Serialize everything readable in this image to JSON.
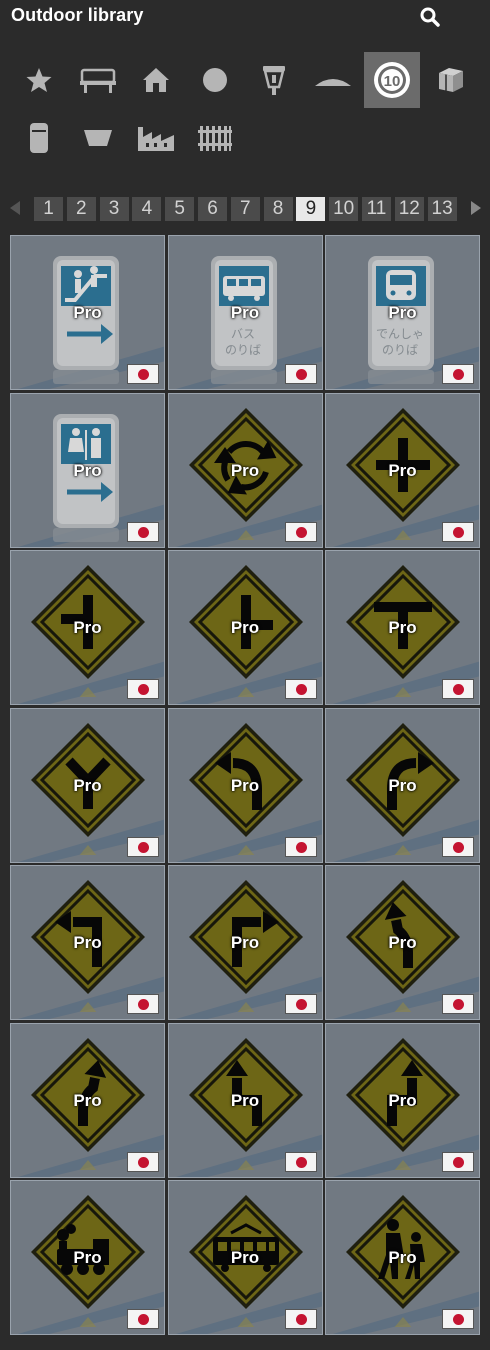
{
  "header": {
    "title": "Outdoor library",
    "search_icon": "search-icon"
  },
  "categories": [
    {
      "id": "favorites",
      "icon": "star-icon",
      "selected": false
    },
    {
      "id": "bench",
      "icon": "bench-icon",
      "selected": false
    },
    {
      "id": "house",
      "icon": "house-icon",
      "selected": false
    },
    {
      "id": "sphere",
      "icon": "sphere-icon",
      "selected": false
    },
    {
      "id": "lantern",
      "icon": "lantern-icon",
      "selected": false
    },
    {
      "id": "mound",
      "icon": "mound-icon",
      "selected": false
    },
    {
      "id": "road-sign",
      "icon": "speed-sign-icon",
      "label": "10",
      "selected": true
    },
    {
      "id": "crate",
      "icon": "crate-icon",
      "selected": false
    },
    {
      "id": "bin",
      "icon": "bin-icon",
      "selected": false
    },
    {
      "id": "planter",
      "icon": "planter-icon",
      "selected": false
    },
    {
      "id": "factory",
      "icon": "factory-icon",
      "selected": false
    },
    {
      "id": "fence",
      "icon": "fence-icon",
      "selected": false
    }
  ],
  "pagination": {
    "prev_icon": "chevron-left-icon",
    "next_icon": "chevron-right-icon",
    "pages": [
      "1",
      "2",
      "3",
      "4",
      "5",
      "6",
      "7",
      "8",
      "9",
      "10",
      "11",
      "12",
      "13"
    ],
    "current": "9"
  },
  "items": [
    {
      "icon": "escalator-guide-sign-icon",
      "badge": "Pro",
      "flag": "japan-flag-icon"
    },
    {
      "icon": "bus-stop-sign-icon",
      "badge": "Pro",
      "flag": "japan-flag-icon",
      "sign_text": "バス のりば"
    },
    {
      "icon": "train-stop-sign-icon",
      "badge": "Pro",
      "flag": "japan-flag-icon",
      "sign_text": "でんしゃ のりば"
    },
    {
      "icon": "restroom-guide-sign-icon",
      "badge": "Pro",
      "flag": "japan-flag-icon"
    },
    {
      "icon": "roundabout-warning-sign-icon",
      "badge": "Pro",
      "flag": "japan-flag-icon"
    },
    {
      "icon": "crossroad-warning-sign-icon",
      "badge": "Pro",
      "flag": "japan-flag-icon"
    },
    {
      "icon": "side-road-left-warning-sign-icon",
      "badge": "Pro",
      "flag": "japan-flag-icon"
    },
    {
      "icon": "side-road-right-warning-sign-icon",
      "badge": "Pro",
      "flag": "japan-flag-icon"
    },
    {
      "icon": "t-junction-warning-sign-icon",
      "badge": "Pro",
      "flag": "japan-flag-icon"
    },
    {
      "icon": "y-junction-warning-sign-icon",
      "badge": "Pro",
      "flag": "japan-flag-icon"
    },
    {
      "icon": "curve-left-warning-sign-icon",
      "badge": "Pro",
      "flag": "japan-flag-icon"
    },
    {
      "icon": "curve-right-warning-sign-icon",
      "badge": "Pro",
      "flag": "japan-flag-icon"
    },
    {
      "icon": "sharp-turn-left-warning-sign-icon",
      "badge": "Pro",
      "flag": "japan-flag-icon"
    },
    {
      "icon": "sharp-turn-right-warning-sign-icon",
      "badge": "Pro",
      "flag": "japan-flag-icon"
    },
    {
      "icon": "reverse-curve-left-warning-sign-icon",
      "badge": "Pro",
      "flag": "japan-flag-icon"
    },
    {
      "icon": "reverse-curve-right-warning-sign-icon",
      "badge": "Pro",
      "flag": "japan-flag-icon"
    },
    {
      "icon": "double-turn-left-warning-sign-icon",
      "badge": "Pro",
      "flag": "japan-flag-icon"
    },
    {
      "icon": "double-turn-right-warning-sign-icon",
      "badge": "Pro",
      "flag": "japan-flag-icon"
    },
    {
      "icon": "railroad-crossing-steam-warning-sign-icon",
      "badge": "Pro",
      "flag": "japan-flag-icon"
    },
    {
      "icon": "railroad-crossing-tram-warning-sign-icon",
      "badge": "Pro",
      "flag": "japan-flag-icon"
    },
    {
      "icon": "school-zone-warning-sign-icon",
      "badge": "Pro",
      "flag": "japan-flag-icon"
    }
  ],
  "colors": {
    "background": "#2b2b2b",
    "sign_yellow": "#7d7413",
    "sign_blue": "#2c7ea6",
    "flag_red": "#c41431"
  }
}
